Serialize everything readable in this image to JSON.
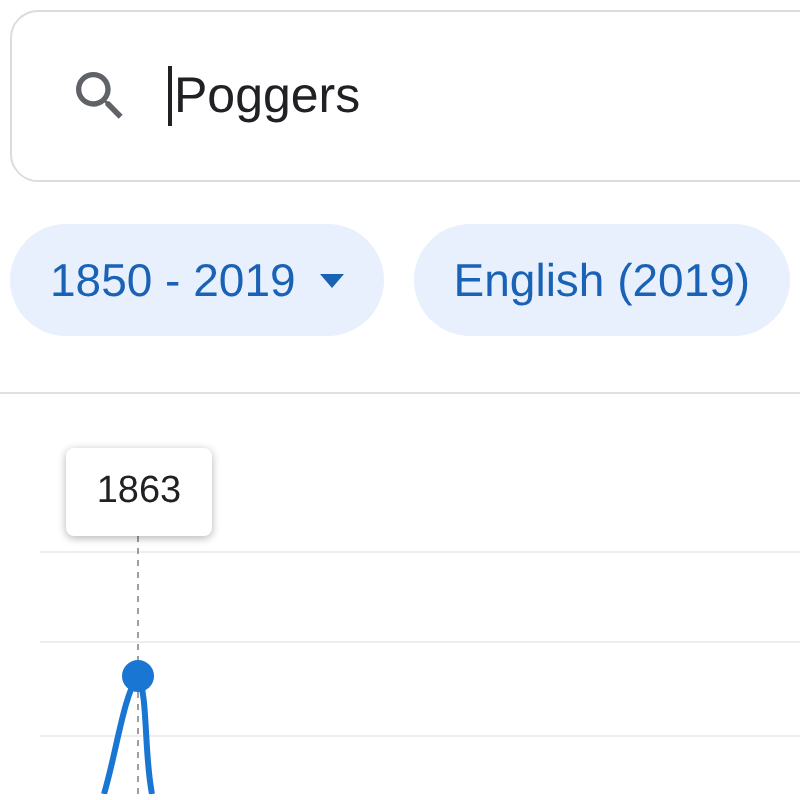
{
  "search": {
    "value": "Poggers",
    "focused": true
  },
  "filters": [
    {
      "label": "1850 - 2019",
      "dropdown": true
    },
    {
      "label": "English (2019)",
      "dropdown": false
    }
  ],
  "chart": {
    "tooltip": "1863"
  }
}
